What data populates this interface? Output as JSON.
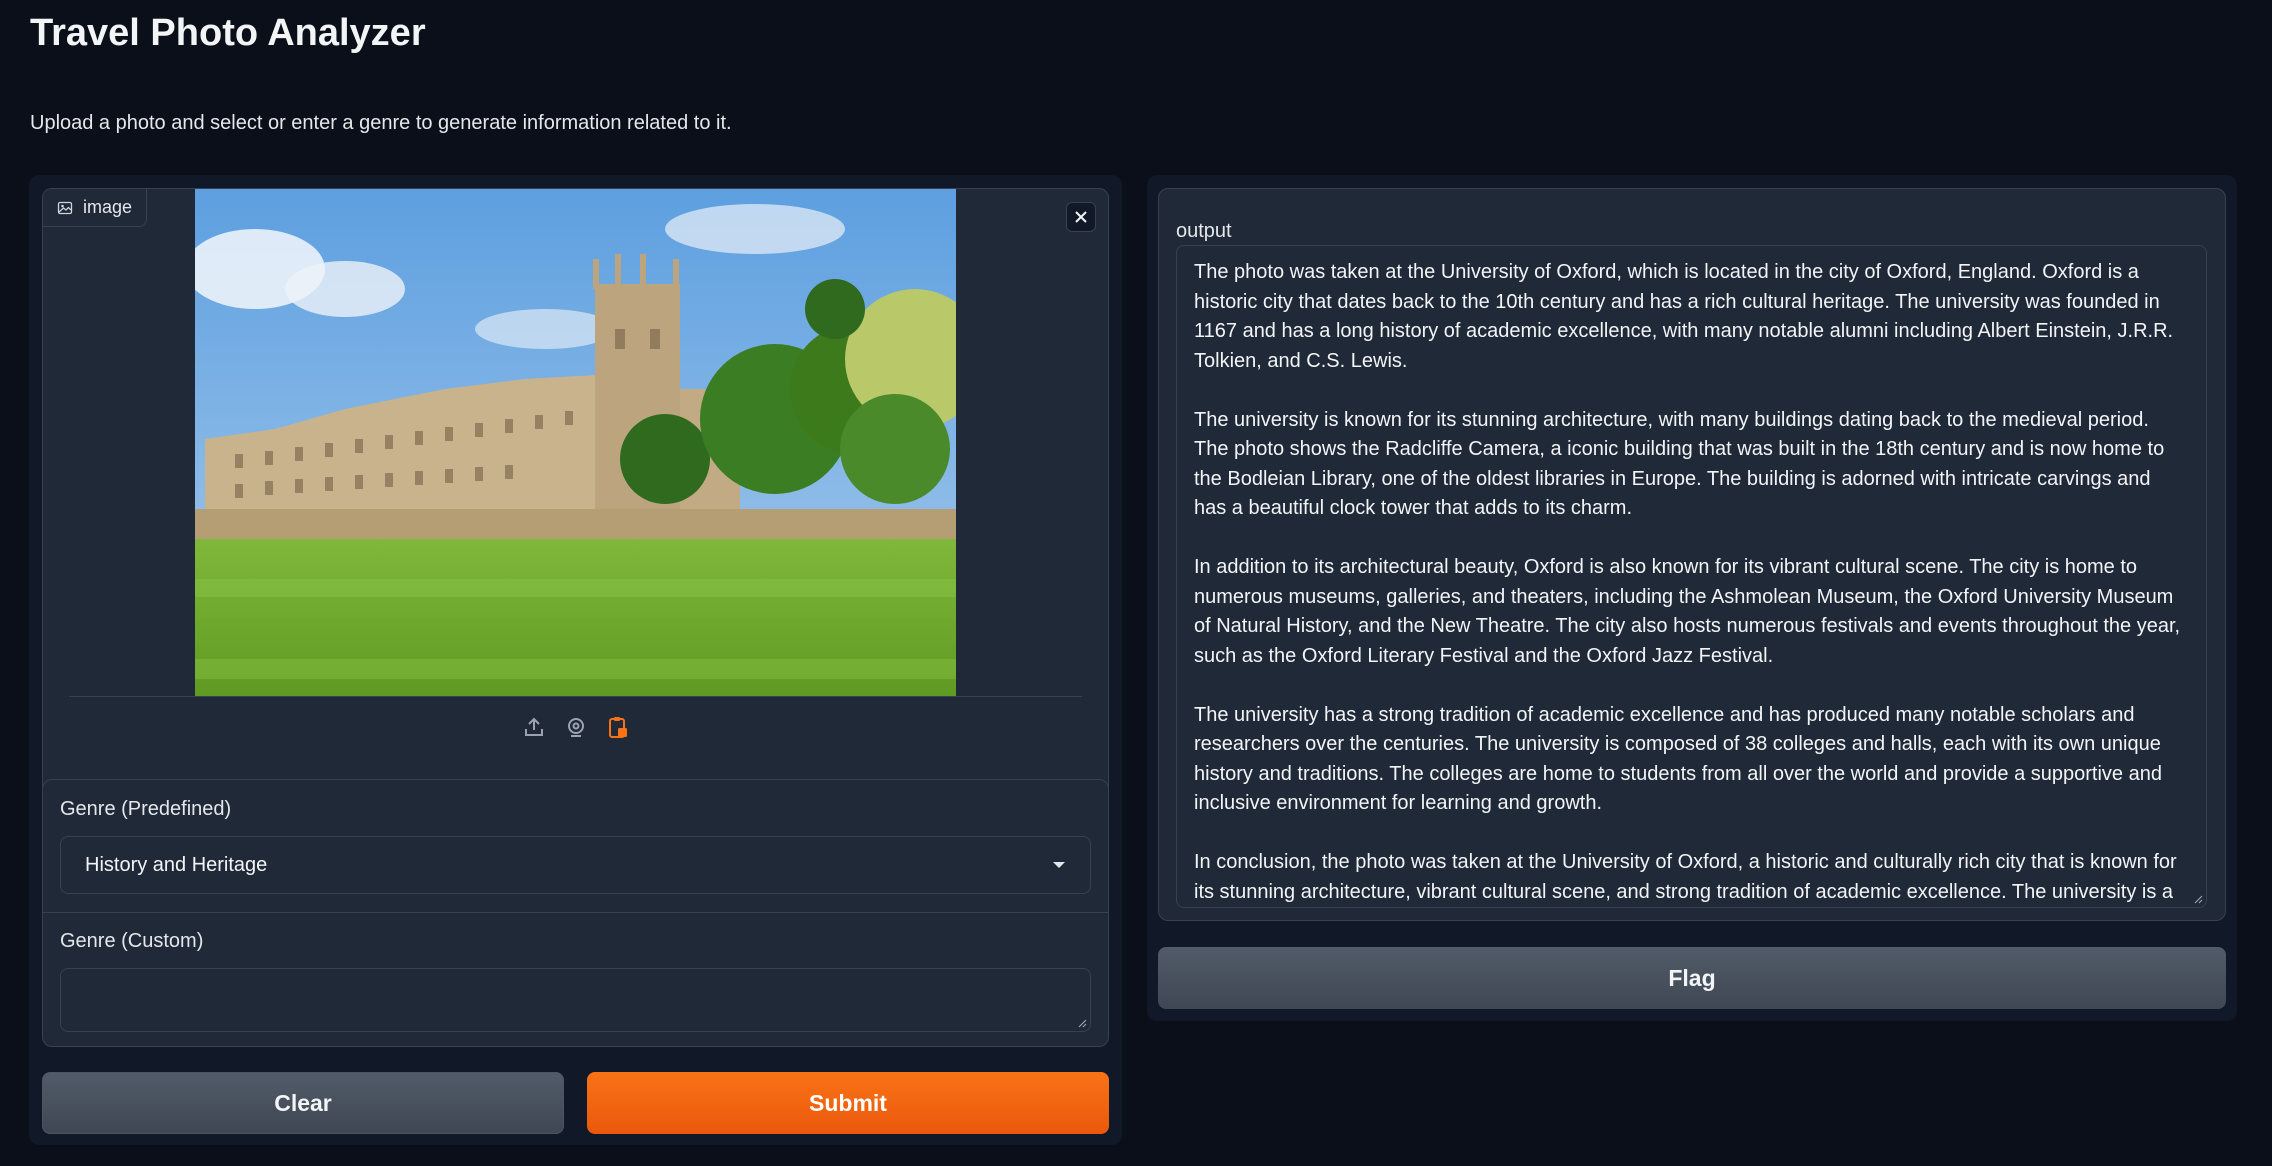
{
  "app": {
    "title": "Travel Photo Analyzer",
    "description": "Upload a photo and select or enter a genre to generate information related to it."
  },
  "image_input": {
    "label": "image",
    "icon": "image-icon",
    "source_icons": [
      "upload-icon",
      "webcam-icon",
      "clipboard-icon"
    ]
  },
  "genre": {
    "predefined_label": "Genre (Predefined)",
    "predefined_value": "History and Heritage",
    "custom_label": "Genre (Custom)",
    "custom_value": ""
  },
  "buttons": {
    "clear": "Clear",
    "submit": "Submit",
    "flag": "Flag"
  },
  "output": {
    "label": "output",
    "paragraphs": [
      "The photo was taken at the University of Oxford, which is located in the city of Oxford, England. Oxford is a historic city that dates back to the 10th century and has a rich cultural heritage. The university was founded in 1167 and has a long history of academic excellence, with many notable alumni including Albert Einstein, J.R.R. Tolkien, and C.S. Lewis.",
      "The university is known for its stunning architecture, with many buildings dating back to the medieval period. The photo shows the Radcliffe Camera, a iconic building that was built in the 18th century and is now home to the Bodleian Library, one of the oldest libraries in Europe. The building is adorned with intricate carvings and has a beautiful clock tower that adds to its charm.",
      "In addition to its architectural beauty, Oxford is also known for its vibrant cultural scene. The city is home to numerous museums, galleries, and theaters, including the Ashmolean Museum, the Oxford University Museum of Natural History, and the New Theatre. The city also hosts numerous festivals and events throughout the year, such as the Oxford Literary Festival and the Oxford Jazz Festival.",
      "The university has a strong tradition of academic excellence and has produced many notable scholars and researchers over the centuries. The university is composed of 38 colleges and halls, each with its own unique history and traditions. The colleges are home to students from all over the world and provide a supportive and inclusive environment for learning and growth.",
      "In conclusion, the photo was taken at the University of Oxford, a historic and culturally rich city that is known for its stunning architecture, vibrant cultural scene, and strong tradition of academic excellence. The university is a"
    ]
  },
  "colors": {
    "background": "#0b0f19",
    "panel": "#1f2937",
    "accent": "#f97316",
    "clipboard_icon": "#f97316"
  }
}
